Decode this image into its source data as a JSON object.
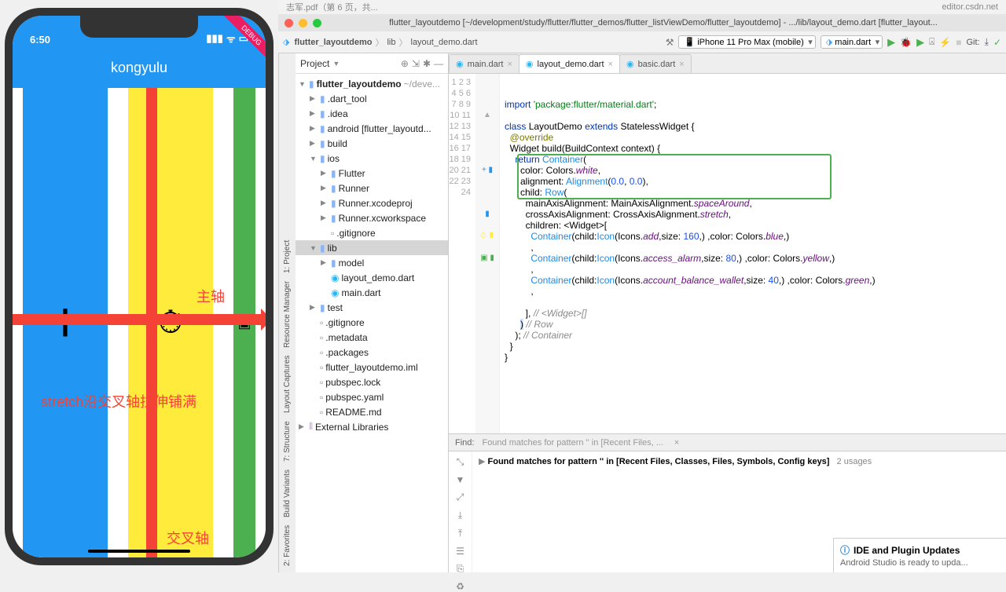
{
  "phone": {
    "time": "6:50",
    "debug": "DEBUG",
    "title": "kongyulu",
    "labels": {
      "main_axis": "主轴",
      "cross_axis": "交叉轴",
      "stretch": "stretch沿交叉轴拉伸铺满"
    }
  },
  "mac_tabs": {
    "left": "志军.pdf（第 6 页，共...",
    "right": "editor.csdn.net"
  },
  "window_title": "flutter_layoutdemo [~/development/study/flutter/flutter_demos/flutter_listViewDemo/flutter_layoutdemo] - .../lib/layout_demo.dart [flutter_layout...",
  "breadcrumbs": [
    "flutter_layoutdemo",
    "lib",
    "layout_demo.dart"
  ],
  "run_config": {
    "device": "iPhone 11 Pro Max (mobile)",
    "target": "main.dart"
  },
  "git_label": "Git:",
  "project_header": "Project",
  "tree": [
    {
      "d": 0,
      "exp": "▼",
      "i": "folder",
      "t": "flutter_layoutdemo",
      "suf": " ~/deve...",
      "bold": true
    },
    {
      "d": 1,
      "exp": "▶",
      "i": "folder",
      "t": ".dart_tool"
    },
    {
      "d": 1,
      "exp": "▶",
      "i": "folder",
      "t": ".idea"
    },
    {
      "d": 1,
      "exp": "▶",
      "i": "folder",
      "t": "android [flutter_layoutd..."
    },
    {
      "d": 1,
      "exp": "▶",
      "i": "folder",
      "t": "build"
    },
    {
      "d": 1,
      "exp": "▼",
      "i": "folder",
      "t": "ios"
    },
    {
      "d": 2,
      "exp": "▶",
      "i": "folder",
      "t": "Flutter"
    },
    {
      "d": 2,
      "exp": "▶",
      "i": "folder",
      "t": "Runner"
    },
    {
      "d": 2,
      "exp": "▶",
      "i": "folder",
      "t": "Runner.xcodeproj"
    },
    {
      "d": 2,
      "exp": "▶",
      "i": "folder",
      "t": "Runner.xcworkspace"
    },
    {
      "d": 2,
      "exp": "",
      "i": "file",
      "t": ".gitignore"
    },
    {
      "d": 1,
      "exp": "▼",
      "i": "folder",
      "t": "lib",
      "sel": true
    },
    {
      "d": 2,
      "exp": "▶",
      "i": "folder",
      "t": "model"
    },
    {
      "d": 2,
      "exp": "",
      "i": "dart",
      "t": "layout_demo.dart"
    },
    {
      "d": 2,
      "exp": "",
      "i": "dart",
      "t": "main.dart"
    },
    {
      "d": 1,
      "exp": "▶",
      "i": "folder",
      "t": "test"
    },
    {
      "d": 1,
      "exp": "",
      "i": "file",
      "t": ".gitignore"
    },
    {
      "d": 1,
      "exp": "",
      "i": "file",
      "t": ".metadata"
    },
    {
      "d": 1,
      "exp": "",
      "i": "file",
      "t": ".packages"
    },
    {
      "d": 1,
      "exp": "",
      "i": "file",
      "t": "flutter_layoutdemo.iml"
    },
    {
      "d": 1,
      "exp": "",
      "i": "file",
      "t": "pubspec.lock"
    },
    {
      "d": 1,
      "exp": "",
      "i": "file",
      "t": "pubspec.yaml"
    },
    {
      "d": 1,
      "exp": "",
      "i": "file",
      "t": "README.md"
    },
    {
      "d": 0,
      "exp": "▶",
      "i": "lib",
      "t": "External Libraries"
    }
  ],
  "side_tools": {
    "project": "1: Project",
    "resmgr": "Resource Manager",
    "captures": "Layout Captures",
    "structure": "7: Structure",
    "variants": "Build Variants",
    "favorites": "2: Favorites"
  },
  "tabs": [
    {
      "label": "main.dart",
      "active": false
    },
    {
      "label": "layout_demo.dart",
      "active": true
    },
    {
      "label": "basic.dart",
      "active": false
    }
  ],
  "code_lines": 24,
  "find": {
    "label": "Find:",
    "placeholder": "Found matches for pattern '' in [Recent Files, ..."
  },
  "results": {
    "text": "Found matches for pattern '' in [Recent Files, Classes, Files, Symbols, Config keys]",
    "usages": "2 usages"
  },
  "toast": {
    "title": "IDE and Plugin Updates",
    "msg": "Android Studio is ready to upda..."
  }
}
